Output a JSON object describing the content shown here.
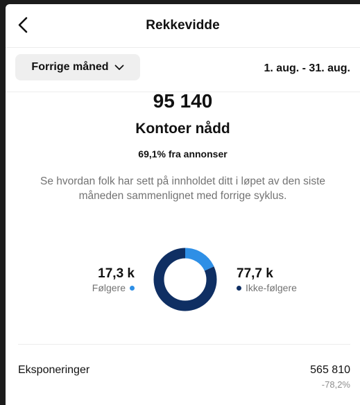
{
  "header": {
    "title": "Rekkevidde"
  },
  "filter": {
    "label": "Forrige måned"
  },
  "date_range": "1. aug. - 31. aug.",
  "summary": {
    "value": "95 140",
    "label": "Kontoer nådd",
    "ads_share": "69,1% fra annonser",
    "description": "Se hvordan folk har sett på innholdet ditt i løpet av den siste måneden sammenlignet med forrige syklus."
  },
  "chart_data": {
    "type": "pie",
    "categories": [
      "Følgere",
      "Ikke-følgere"
    ],
    "values": [
      17.3,
      77.7
    ],
    "value_labels": [
      "17,3 k",
      "77,7 k"
    ],
    "colors": [
      "#2e8fe6",
      "#0f2f63"
    ]
  },
  "metrics": [
    {
      "label": "Eksponeringer",
      "value": "565 810",
      "change": "-78,2%"
    }
  ]
}
